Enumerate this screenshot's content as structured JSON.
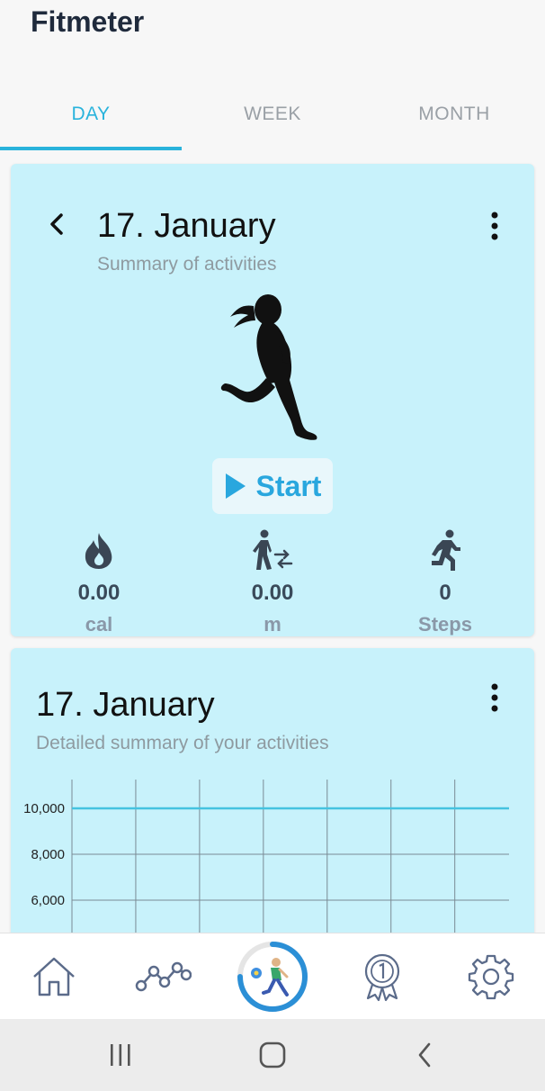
{
  "app": {
    "title": "Fitmeter"
  },
  "tabs": [
    {
      "label": "DAY",
      "active": true
    },
    {
      "label": "WEEK",
      "active": false
    },
    {
      "label": "MONTH",
      "active": false
    }
  ],
  "summary_card": {
    "date": "17. January",
    "subtitle": "Summary of activities",
    "start_label": "Start",
    "stats": [
      {
        "icon": "fire-icon",
        "value": "0.00",
        "unit": "cal"
      },
      {
        "icon": "walk-distance-icon",
        "value": "0.00",
        "unit": "m"
      },
      {
        "icon": "running-steps-icon",
        "value": "0",
        "unit": "Steps"
      }
    ]
  },
  "detail_card": {
    "date": "17. January",
    "subtitle": "Detailed summary of your activities"
  },
  "chart_data": {
    "type": "line",
    "title": "",
    "xlabel": "",
    "ylabel": "",
    "y_ticks": [
      "10,000",
      "8,000",
      "6,000"
    ],
    "ylim_visible": [
      6000,
      10000
    ],
    "series": [
      {
        "values": [
          10000,
          10000,
          10000,
          10000,
          10000,
          10000,
          10000,
          10000
        ]
      }
    ],
    "grid": true,
    "line_color": "#45c3e0"
  },
  "bottom_nav": [
    {
      "name": "home-icon"
    },
    {
      "name": "stats-graph-icon"
    },
    {
      "name": "activity-runner-icon",
      "progress": 0.75
    },
    {
      "name": "award-medal-icon"
    },
    {
      "name": "settings-gear-icon"
    }
  ],
  "colors": {
    "accent": "#29b3dc",
    "card_bg": "#c8f2fb"
  }
}
